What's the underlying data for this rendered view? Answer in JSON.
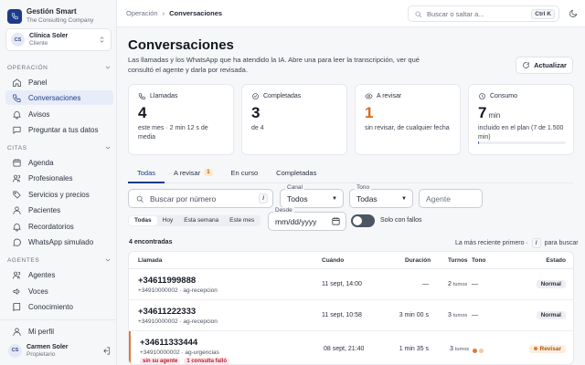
{
  "brand": {
    "name": "Gestión Smart",
    "subtitle": "The Consulting Company"
  },
  "client": {
    "initials": "CS",
    "name": "Clínica Soler",
    "role": "Cliente"
  },
  "sidebar": {
    "sections": {
      "operacion": "Operación",
      "citas": "Citas",
      "agentes": "Agentes"
    },
    "items": [
      {
        "label": "Panel",
        "icon": "home-icon"
      },
      {
        "label": "Conversaciones",
        "icon": "phone-icon"
      },
      {
        "label": "Avisos",
        "icon": "bell-icon"
      },
      {
        "label": "Preguntar a tus datos",
        "icon": "chat-icon"
      },
      {
        "label": "Agenda",
        "icon": "calendar-icon"
      },
      {
        "label": "Profesionales",
        "icon": "users-icon"
      },
      {
        "label": "Servicios y precios",
        "icon": "tag-icon"
      },
      {
        "label": "Pacientes",
        "icon": "patients-icon"
      },
      {
        "label": "Recordatorios",
        "icon": "bell-icon"
      },
      {
        "label": "WhatsApp simulado",
        "icon": "whatsapp-icon"
      },
      {
        "label": "Agentes",
        "icon": "agents-icon"
      },
      {
        "label": "Voces",
        "icon": "voice-icon"
      },
      {
        "label": "Conocimiento",
        "icon": "book-icon"
      },
      {
        "label": "Mi perfil",
        "icon": "user-icon"
      }
    ]
  },
  "user": {
    "initials": "CS",
    "name": "Carmen Soler",
    "role": "Propietario"
  },
  "topbar": {
    "breadcrumb": [
      "Operación",
      "Conversaciones"
    ],
    "search_placeholder": "Buscar o saltar a...",
    "search_shortcut": "Ctrl K"
  },
  "page": {
    "title": "Conversaciones",
    "subtitle": "Las llamadas y los WhatsApp que ha atendido la IA. Abre una para leer la transcripción, ver qué consultó el agente y darla por revisada.",
    "refresh_label": "Actualizar"
  },
  "cards": [
    {
      "label": "Llamadas",
      "value": "4",
      "unit": "",
      "note": "este mes · 2 min 12 s de media"
    },
    {
      "label": "Completadas",
      "value": "3",
      "unit": "",
      "note": "de 4"
    },
    {
      "label": "A revisar",
      "value": "1",
      "unit": "",
      "note": "sin revisar, de cualquier fecha"
    },
    {
      "label": "Consumo",
      "value": "7",
      "unit": "min",
      "note": "incluido en el plan (7 de 1.500 min)",
      "progress": 0.005
    }
  ],
  "tabs": [
    {
      "label": "Todas"
    },
    {
      "label": "A revisar",
      "badge": "1"
    },
    {
      "label": "En curso"
    },
    {
      "label": "Completadas"
    }
  ],
  "filters": {
    "search_placeholder": "Buscar por número",
    "search_shortcut": "/",
    "canal_label": "Canal",
    "canal_value": "Todos",
    "tono_label": "Tono",
    "tono_value": "Todas",
    "agent_placeholder": "Agente",
    "periods": [
      "Todas",
      "Hoy",
      "Esta semana",
      "Este mes"
    ],
    "desde_label": "Desde",
    "desde_value": "mm/dd/yyyy",
    "toggle_label": "Solo con fallos"
  },
  "list": {
    "count": "4 encontradas",
    "sort_text": "La más reciente primero ·",
    "sort_kbd": "/",
    "sort_suffix": "para buscar"
  },
  "table": {
    "headers": [
      "Llamada",
      "Cuándo",
      "Duración",
      "Turnos",
      "Tono",
      "Estado"
    ],
    "turns_unit": "turnos",
    "rows": [
      {
        "phone": "+34611999888",
        "meta": "+34910000002 · ag-recepcion",
        "when": "11 sept, 14:00",
        "duration": "—",
        "turns": "2",
        "tone": "—",
        "status": "Normal"
      },
      {
        "phone": "+34611222333",
        "meta": "+34910000002 · ag-recepcion",
        "when": "11 sept, 10:58",
        "duration": "3 min 00 s",
        "turns": "3",
        "tone": "—",
        "status": "Normal"
      },
      {
        "phone": "+34611333444",
        "meta": "+34910000002 · ag-urgencias",
        "when": "08 sept, 21:40",
        "duration": "1 min 35 s",
        "turns": "3",
        "tone_colors": [
          "#e07a3a",
          "#f2c9a6"
        ],
        "status": "Revisar",
        "tags": [
          "sin su agente",
          "1 consulta falló"
        ]
      }
    ]
  }
}
